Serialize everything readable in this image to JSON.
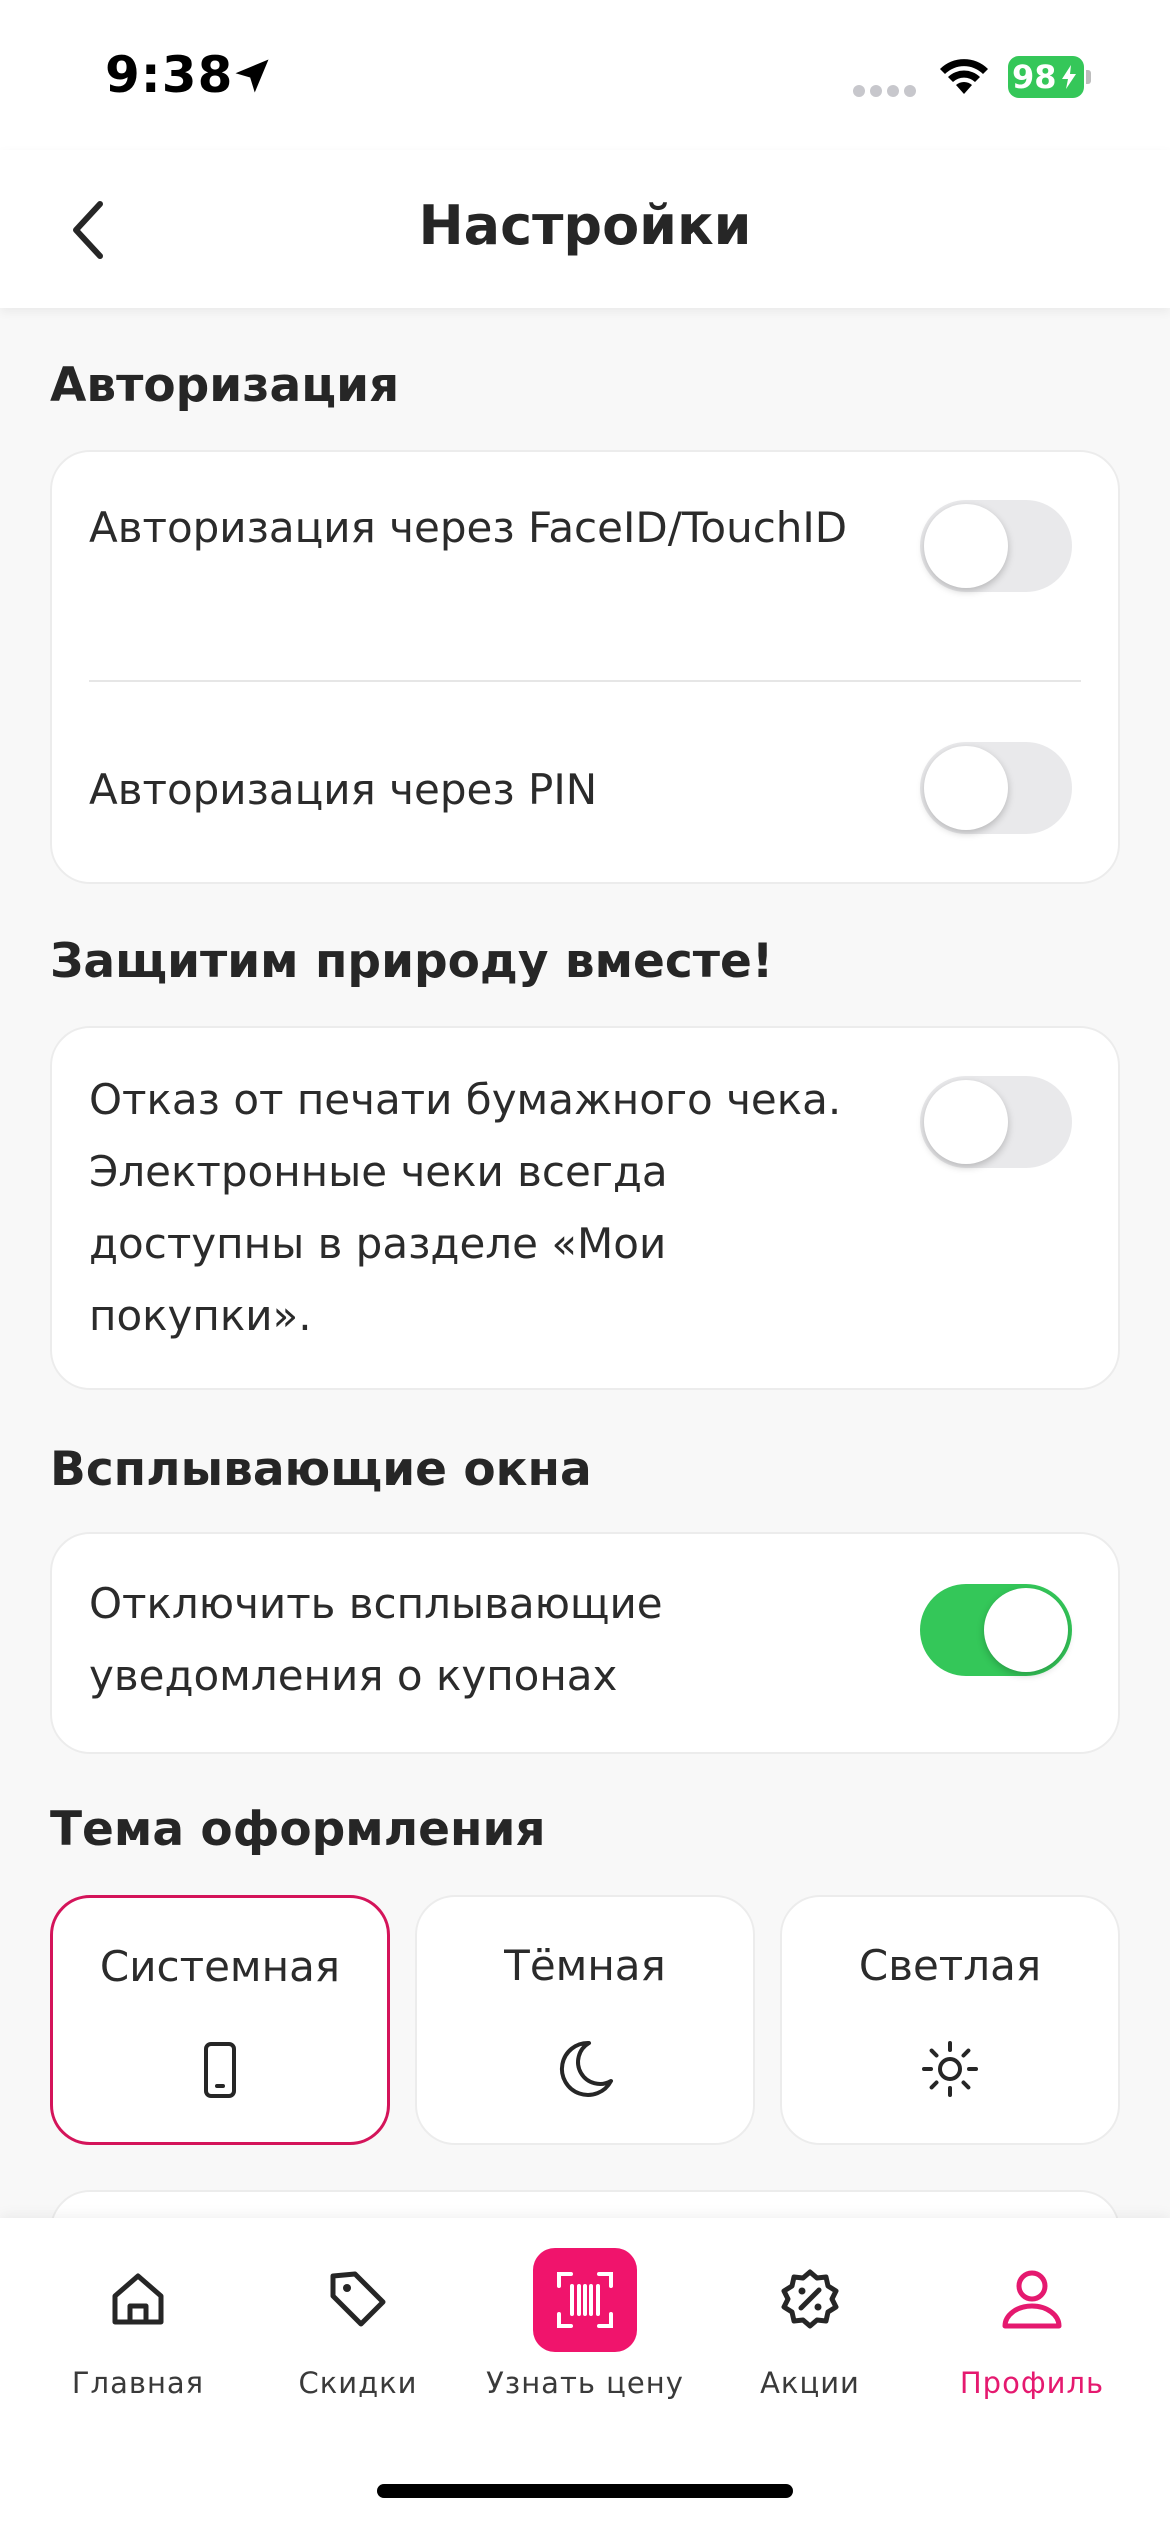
{
  "status_bar": {
    "time": "9:38",
    "battery": "98",
    "icons": [
      "location-arrow-icon",
      "cellular-signal-icon",
      "wifi-icon",
      "battery-charging-icon"
    ]
  },
  "header": {
    "title": "Настройки",
    "back_icon": "chevron-left-icon"
  },
  "sections": {
    "auth": {
      "title": "Авторизация",
      "faceid_label": "Авторизация через FaceID/TouchID",
      "faceid_enabled": false,
      "pin_label": "Авторизация через PIN",
      "pin_enabled": false
    },
    "eco": {
      "title": "Защитим природу вместе!",
      "paper_receipt_label": "Отказ от печати бумажного чека. Электронные чеки всегда доступны в разделе «Мои покупки».",
      "paper_receipt_enabled": false
    },
    "popups": {
      "title": "Всплывающие окна",
      "coupon_popups_label": "Отключить всплывающие уведомления о купонах",
      "coupon_popups_enabled": true
    },
    "theme": {
      "title": "Тема оформления",
      "options": [
        {
          "label": "Системная",
          "icon": "phone-icon",
          "selected": true
        },
        {
          "label": "Тёмная",
          "icon": "moon-icon",
          "selected": false
        },
        {
          "label": "Светлая",
          "icon": "sun-icon",
          "selected": false
        }
      ]
    }
  },
  "tabbar": {
    "items": [
      {
        "label": "Главная",
        "icon": "home-icon"
      },
      {
        "label": "Скидки",
        "icon": "tag-icon"
      },
      {
        "label": "Узнать цену",
        "icon": "barcode-scan-icon"
      },
      {
        "label": "Акции",
        "icon": "percent-badge-icon"
      },
      {
        "label": "Профиль",
        "icon": "profile-icon",
        "active": true
      }
    ]
  },
  "colors": {
    "accent": "#e5196f",
    "toggle_on": "#34c759",
    "background": "#f8f8f8"
  }
}
